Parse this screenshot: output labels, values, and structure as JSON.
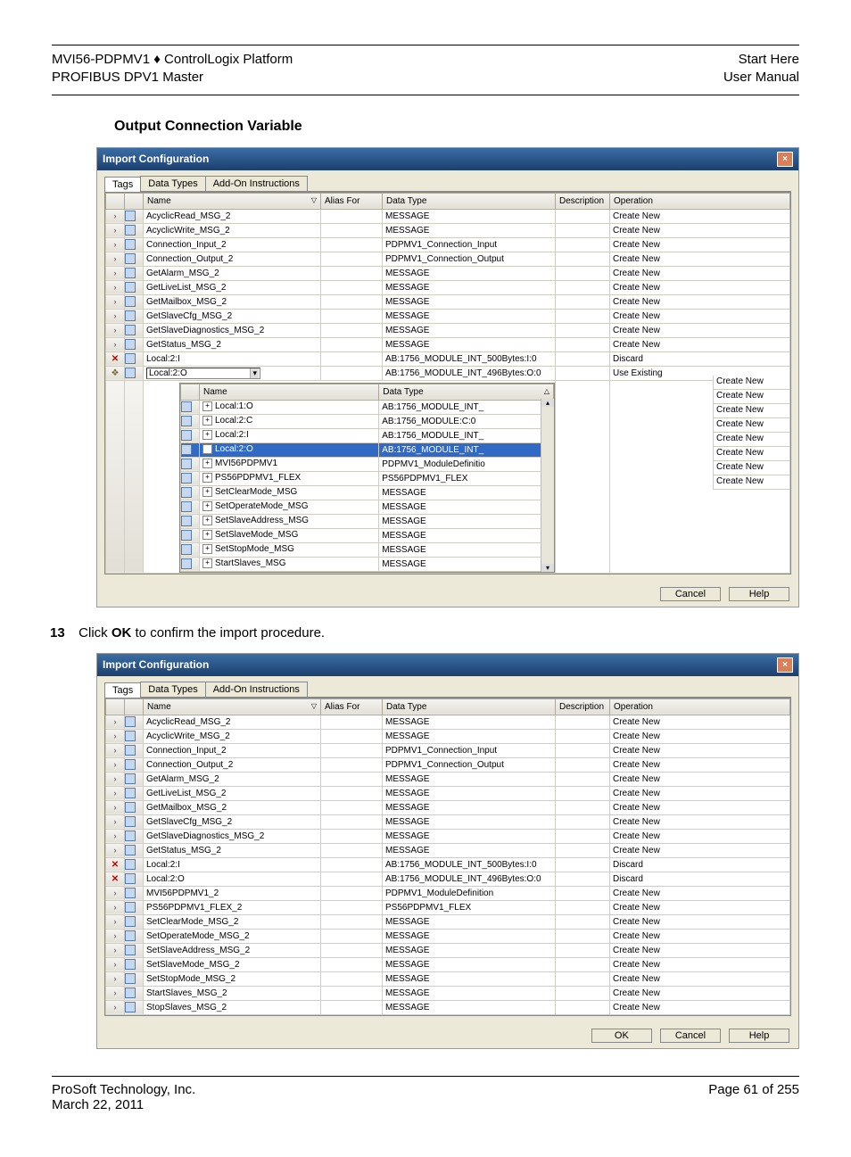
{
  "header": {
    "left1": "MVI56-PDPMV1 ♦ ControlLogix Platform",
    "left2": "PROFIBUS DPV1 Master",
    "right1": "Start Here",
    "right2": "User Manual"
  },
  "section_title": "Output Connection Variable",
  "step": {
    "num": "13",
    "prefix": "Click ",
    "bold": "OK",
    "suffix": " to confirm the import procedure."
  },
  "dlg": {
    "title": "Import Configuration",
    "tabs": [
      "Tags",
      "Data Types",
      "Add-On Instructions"
    ],
    "cols": {
      "name": "Name",
      "alias": "Alias For",
      "dtype": "Data Type",
      "desc": "Description",
      "op": "Operation"
    },
    "buttons": {
      "ok": "OK",
      "cancel": "Cancel",
      "help": "Help"
    }
  },
  "dlg1_rows": [
    {
      "icon": "tag",
      "name": "AcyclicRead_MSG_2",
      "dtype": "MESSAGE",
      "op": "Create New"
    },
    {
      "icon": "tag",
      "name": "AcyclicWrite_MSG_2",
      "dtype": "MESSAGE",
      "op": "Create New"
    },
    {
      "icon": "tag",
      "name": "Connection_Input_2",
      "dtype": "PDPMV1_Connection_Input",
      "op": "Create New"
    },
    {
      "icon": "tag",
      "name": "Connection_Output_2",
      "dtype": "PDPMV1_Connection_Output",
      "op": "Create New"
    },
    {
      "icon": "tag",
      "name": "GetAlarm_MSG_2",
      "dtype": "MESSAGE",
      "op": "Create New"
    },
    {
      "icon": "tag",
      "name": "GetLiveList_MSG_2",
      "dtype": "MESSAGE",
      "op": "Create New"
    },
    {
      "icon": "tag",
      "name": "GetMailbox_MSG_2",
      "dtype": "MESSAGE",
      "op": "Create New"
    },
    {
      "icon": "tag",
      "name": "GetSlaveCfg_MSG_2",
      "dtype": "MESSAGE",
      "op": "Create New"
    },
    {
      "icon": "tag",
      "name": "GetSlaveDiagnostics_MSG_2",
      "dtype": "MESSAGE",
      "op": "Create New"
    },
    {
      "icon": "tag",
      "name": "GetStatus_MSG_2",
      "dtype": "MESSAGE",
      "op": "Create New"
    },
    {
      "icon": "x",
      "name": "Local:2:I",
      "dtype": "AB:1756_MODULE_INT_500Bytes:I:0",
      "op": "Discard"
    },
    {
      "icon": "leaf",
      "name": "Local:2:O",
      "dtype": "AB:1756_MODULE_INT_496Bytes:O:0",
      "op": "Use Existing",
      "dropdown": true,
      "expand": true
    }
  ],
  "dlg1_sub_cols": {
    "name": "Name",
    "dtype": "Data Type"
  },
  "dlg1_sub": [
    {
      "exp": "+",
      "name": "Local:1:O",
      "dtype": "AB:1756_MODULE_INT_"
    },
    {
      "exp": "+",
      "name": "Local:2:C",
      "dtype": "AB:1756_MODULE:C:0"
    },
    {
      "exp": "+",
      "name": "Local:2:I",
      "dtype": "AB:1756_MODULE_INT_"
    },
    {
      "exp": "+",
      "name": "Local:2:O",
      "dtype": "AB:1756_MODULE_INT_",
      "sel": true
    },
    {
      "exp": "+",
      "name": "MVI56PDPMV1",
      "dtype": "PDPMV1_ModuleDefinitio"
    },
    {
      "exp": "+",
      "name": "PS56PDPMV1_FLEX",
      "dtype": "PS56PDPMV1_FLEX"
    },
    {
      "exp": "+",
      "name": "SetClearMode_MSG",
      "dtype": "MESSAGE"
    },
    {
      "exp": "+",
      "name": "SetOperateMode_MSG",
      "dtype": "MESSAGE"
    },
    {
      "exp": "+",
      "name": "SetSlaveAddress_MSG",
      "dtype": "MESSAGE"
    },
    {
      "exp": "+",
      "name": "SetSlaveMode_MSG",
      "dtype": "MESSAGE"
    },
    {
      "exp": "+",
      "name": "SetStopMode_MSG",
      "dtype": "MESSAGE"
    },
    {
      "exp": "+",
      "name": "StartSlaves_MSG",
      "dtype": "MESSAGE"
    }
  ],
  "dlg1_tail_ops": [
    "Create New",
    "Create New",
    "Create New",
    "Create New",
    "Create New",
    "Create New",
    "Create New",
    "Create New"
  ],
  "dlg2_rows": [
    {
      "icon": "tag",
      "name": "AcyclicRead_MSG_2",
      "dtype": "MESSAGE",
      "op": "Create New"
    },
    {
      "icon": "tag",
      "name": "AcyclicWrite_MSG_2",
      "dtype": "MESSAGE",
      "op": "Create New"
    },
    {
      "icon": "tag",
      "name": "Connection_Input_2",
      "dtype": "PDPMV1_Connection_Input",
      "op": "Create New"
    },
    {
      "icon": "tag",
      "name": "Connection_Output_2",
      "dtype": "PDPMV1_Connection_Output",
      "op": "Create New"
    },
    {
      "icon": "tag",
      "name": "GetAlarm_MSG_2",
      "dtype": "MESSAGE",
      "op": "Create New"
    },
    {
      "icon": "tag",
      "name": "GetLiveList_MSG_2",
      "dtype": "MESSAGE",
      "op": "Create New"
    },
    {
      "icon": "tag",
      "name": "GetMailbox_MSG_2",
      "dtype": "MESSAGE",
      "op": "Create New"
    },
    {
      "icon": "tag",
      "name": "GetSlaveCfg_MSG_2",
      "dtype": "MESSAGE",
      "op": "Create New"
    },
    {
      "icon": "tag",
      "name": "GetSlaveDiagnostics_MSG_2",
      "dtype": "MESSAGE",
      "op": "Create New"
    },
    {
      "icon": "tag",
      "name": "GetStatus_MSG_2",
      "dtype": "MESSAGE",
      "op": "Create New"
    },
    {
      "icon": "x",
      "name": "Local:2:I",
      "dtype": "AB:1756_MODULE_INT_500Bytes:I:0",
      "op": "Discard"
    },
    {
      "icon": "x",
      "name": "Local:2:O",
      "dtype": "AB:1756_MODULE_INT_496Bytes:O:0",
      "op": "Discard"
    },
    {
      "icon": "tag",
      "name": "MVI56PDPMV1_2",
      "dtype": "PDPMV1_ModuleDefinition",
      "op": "Create New"
    },
    {
      "icon": "tag",
      "name": "PS56PDPMV1_FLEX_2",
      "dtype": "PS56PDPMV1_FLEX",
      "op": "Create New"
    },
    {
      "icon": "tag",
      "name": "SetClearMode_MSG_2",
      "dtype": "MESSAGE",
      "op": "Create New"
    },
    {
      "icon": "tag",
      "name": "SetOperateMode_MSG_2",
      "dtype": "MESSAGE",
      "op": "Create New"
    },
    {
      "icon": "tag",
      "name": "SetSlaveAddress_MSG_2",
      "dtype": "MESSAGE",
      "op": "Create New"
    },
    {
      "icon": "tag",
      "name": "SetSlaveMode_MSG_2",
      "dtype": "MESSAGE",
      "op": "Create New"
    },
    {
      "icon": "tag",
      "name": "SetStopMode_MSG_2",
      "dtype": "MESSAGE",
      "op": "Create New"
    },
    {
      "icon": "tag",
      "name": "StartSlaves_MSG_2",
      "dtype": "MESSAGE",
      "op": "Create New"
    },
    {
      "icon": "tag",
      "name": "StopSlaves_MSG_2",
      "dtype": "MESSAGE",
      "op": "Create New"
    }
  ],
  "footer": {
    "left1": "ProSoft Technology, Inc.",
    "left2": "March 22, 2011",
    "right": "Page 61 of 255"
  }
}
